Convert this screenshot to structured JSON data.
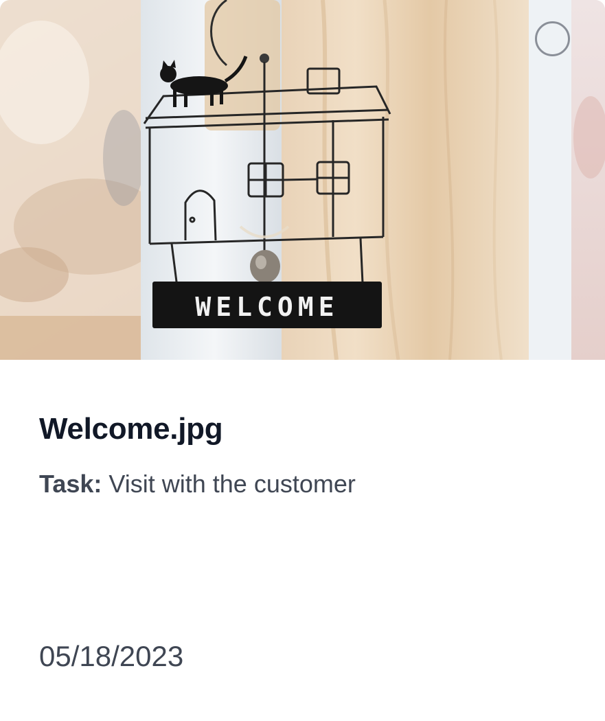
{
  "card": {
    "file_name": "Welcome.jpg",
    "task_label": "Task:",
    "task_value": "Visit with the customer",
    "date": "05/18/2023",
    "thumbnail_sign_text": "WELCOME",
    "select_icon": "circle-checkbox-icon"
  },
  "colors": {
    "title": "#111827",
    "body_text": "#3f4653",
    "select_circle": "#8a8f98",
    "sign_background": "#141414",
    "sign_text": "#f2f2f2"
  }
}
